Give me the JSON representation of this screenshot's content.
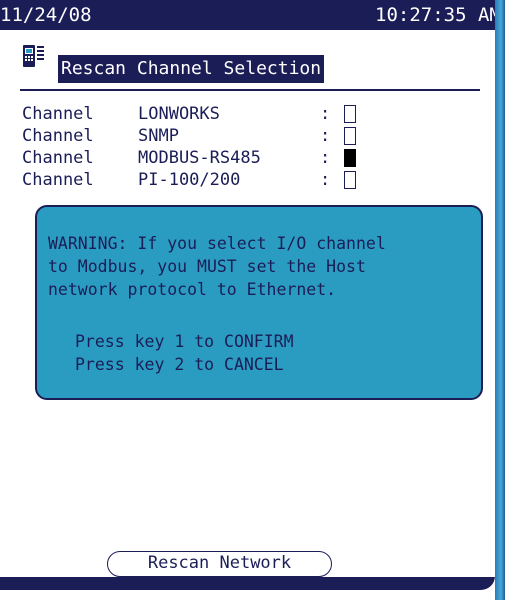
{
  "status_bar": {
    "date": "11/24/08",
    "time": "10:27:35 AM"
  },
  "header": {
    "icon": "device-icon",
    "title": "Rescan Channel Selection"
  },
  "channels": [
    {
      "label": "Channel",
      "name": "LONWORKS",
      "separator": ":",
      "selected": false
    },
    {
      "label": "Channel",
      "name": "SNMP",
      "separator": ":",
      "selected": false
    },
    {
      "label": "Channel",
      "name": "MODBUS-RS485",
      "separator": ":",
      "selected": true
    },
    {
      "label": "Channel",
      "name": "PI-100/200",
      "separator": ":",
      "selected": false
    }
  ],
  "warning": {
    "lines": [
      "WARNING: If you select I/O channel",
      "to Modbus, you MUST set the Host",
      "network protocol to Ethernet."
    ],
    "confirm": "Press key 1 to CONFIRM",
    "cancel": "Press key 2 to CANCEL"
  },
  "footer": {
    "rescan_button": "Rescan Network"
  },
  "colors": {
    "navy": "#1b1d57",
    "dialog_teal": "#2b9cc1",
    "bezel_blue": "#2a7db8",
    "background": "#ffffff"
  }
}
